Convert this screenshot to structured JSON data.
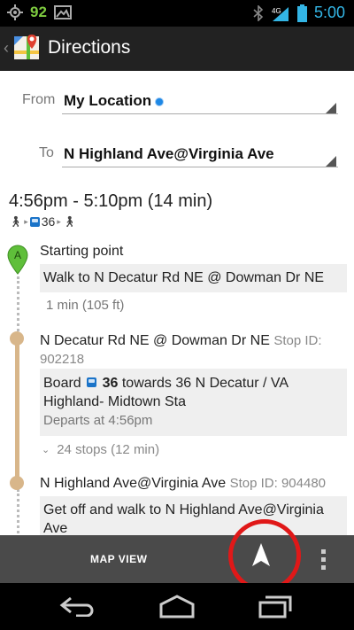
{
  "status_bar": {
    "notification_count": "92",
    "network": "4G",
    "time": "5:00"
  },
  "action_bar": {
    "title": "Directions"
  },
  "form": {
    "from_label": "From",
    "from_value": "My Location",
    "to_label": "To",
    "to_value": "N Highland Ave@Virginia Ave"
  },
  "summary": {
    "time_range": "4:56pm - 5:10pm (14 min)",
    "route_number": "36"
  },
  "steps": [
    {
      "title": "Starting point",
      "instruction": "Walk to N Decatur Rd NE @ Dowman Dr NE",
      "duration": "1 min (105 ft)"
    },
    {
      "title": "N Decatur Rd NE @ Dowman Dr NE",
      "stop_id": "Stop ID: 902218",
      "board_prefix": "Board",
      "route": "36",
      "board_towards": "towards 36 N Decatur / VA Highland- Midtown Sta",
      "departs": "Departs at 4:56pm",
      "stops_summary": "24 stops (12 min)"
    },
    {
      "title": "N Highland Ave@Virginia Ave",
      "stop_id": "Stop ID: 904480",
      "instruction": "Get off and walk to N Highland Ave@Virginia Ave"
    }
  ],
  "bottom_bar": {
    "map_view_label": "MAP VIEW"
  },
  "icons": {
    "gps": "gps-icon",
    "picture": "picture-icon",
    "bluetooth": "bluetooth-icon",
    "signal": "signal-icon",
    "battery": "battery-icon",
    "maps_logo": "maps-logo-icon",
    "navigate": "navigation-arrow-icon",
    "overflow": "overflow-menu-icon",
    "back": "back-icon",
    "home": "home-icon",
    "recents": "recents-icon"
  },
  "colors": {
    "accent_blue": "#33b5e5",
    "route_line": "#d8b68a",
    "pin_green": "#5fbf3a",
    "highlight_red": "#e01818"
  }
}
